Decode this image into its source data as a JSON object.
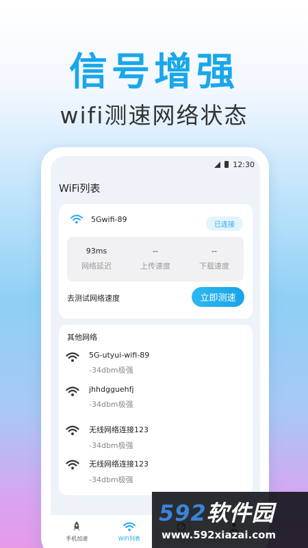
{
  "promo": {
    "headline": "信号增强",
    "subline": "wifi测速网络状态"
  },
  "status_bar": {
    "time": "12:30"
  },
  "page_title": "WiFi列表",
  "current_network": {
    "name": "5Gwifi-89",
    "status_badge": "已连接",
    "stats": [
      {
        "value": "93ms",
        "label": "网络延迟"
      },
      {
        "value": "--",
        "label": "上传速度"
      },
      {
        "value": "--",
        "label": "下载速度"
      }
    ],
    "test_prompt": "去测试网络速度",
    "test_button": "立即测速"
  },
  "other_networks": {
    "title": "其他网络",
    "items": [
      {
        "name": "5G-utyui-wifi-89",
        "strength": "-34dbm极强"
      },
      {
        "name": "jhhdgguehfj",
        "strength": "-34dbm极强"
      },
      {
        "name": "无线网络连接123",
        "strength": "-34dbm极强"
      },
      {
        "name": "无线网络连接123",
        "strength": "-34dbm极强"
      }
    ]
  },
  "tabs": [
    {
      "label": "手机加速",
      "icon": "rocket-icon",
      "active": false
    },
    {
      "label": "WiFi列表",
      "icon": "wifi-icon",
      "active": true
    },
    {
      "label": "",
      "icon": "gauge-icon",
      "active": false
    },
    {
      "label": "",
      "icon": "user-icon",
      "active": false
    }
  ],
  "watermark": {
    "number": "592",
    "brand": "软件园",
    "url": "www.592xiazai.com"
  },
  "colors": {
    "accent": "#1aa3e8",
    "headline": "#19a7ea"
  }
}
